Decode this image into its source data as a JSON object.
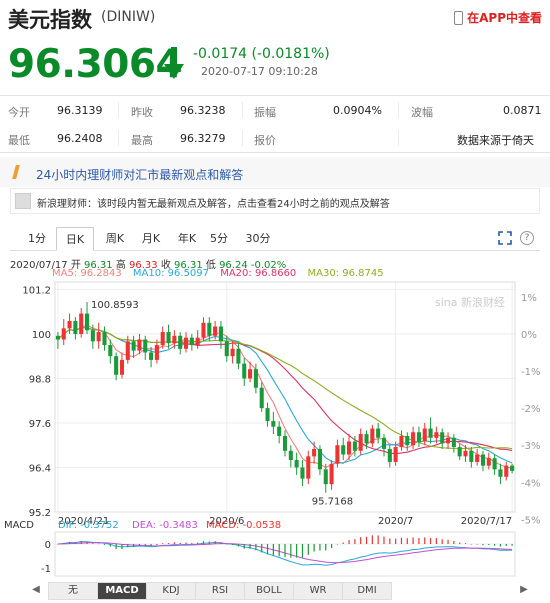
{
  "header": {
    "title": "美元指数",
    "code": "(DINIW)",
    "app_link": "在APP中查看",
    "price": "96.3064",
    "change": "-0.0174 (-0.0181%)",
    "time": "2020-07-17 09:10:28"
  },
  "quote": {
    "row1": [
      {
        "label": "今开",
        "value": "96.3139"
      },
      {
        "label": "昨收",
        "value": "96.3238"
      },
      {
        "label": "振幅",
        "value": "0.0904%"
      },
      {
        "label": "波幅",
        "value": "0.0871"
      }
    ],
    "row2": [
      {
        "label": "最低",
        "value": "96.2408"
      },
      {
        "label": "最高",
        "value": "96.3279"
      },
      {
        "label": "报价",
        "value": ""
      },
      {
        "label": "",
        "value": "数据来源于倚天"
      }
    ]
  },
  "banner": "24小时内理财师对汇市最新观点和解答",
  "advisor": "新浪理财师：该时段内暂无最新观点及解答，点击查看24小时之前的观点及解答",
  "tabs": [
    "1分",
    "日K",
    "周K",
    "月K",
    "年K",
    "5分",
    "30分"
  ],
  "active_tab": "日K",
  "ohlc_info": {
    "date": "2020/07/17",
    "open_label": "开",
    "open": "96.31",
    "high_label": "高",
    "high": "96.33",
    "close_label": "收",
    "close": "96.31",
    "low_label": "低",
    "low": "96.24",
    "pct": "-0.02%"
  },
  "ma": [
    {
      "text": "MA5: 96.2843",
      "color": "#f08080"
    },
    {
      "text": "MA10: 96.5097",
      "color": "#2aa8d6"
    },
    {
      "text": "MA20: 96.8660",
      "color": "#e0306a"
    },
    {
      "text": "MA30: 96.8745",
      "color": "#8ab020"
    }
  ],
  "watermark": "sina 新浪财经",
  "chart_data": {
    "type": "candlestick",
    "y_ticks": [
      "101.2",
      "100",
      "98.8",
      "97.6",
      "96.4",
      "95.2"
    ],
    "pct_ticks": [
      "1%",
      "0%",
      "-1%",
      "-2%",
      "-3%",
      "-4%",
      "-5%"
    ],
    "x_labels": [
      "2020/4/21",
      "2020/6",
      "2020/7",
      "2020/7/17"
    ],
    "max_label": "100.8593",
    "min_label": "95.7168",
    "y_range": [
      95.2,
      101.4
    ],
    "candles": [
      [
        99.95,
        99.85,
        100.05,
        99.6
      ],
      [
        99.85,
        100.15,
        100.4,
        99.7
      ],
      [
        100.15,
        100.35,
        100.55,
        100.0
      ],
      [
        100.35,
        100.0,
        100.45,
        99.85
      ],
      [
        100.0,
        100.55,
        100.7,
        99.9
      ],
      [
        100.55,
        100.1,
        100.86,
        100.0
      ],
      [
        100.1,
        99.8,
        100.25,
        99.6
      ],
      [
        99.8,
        100.05,
        100.3,
        99.6
      ],
      [
        100.05,
        99.7,
        100.2,
        99.55
      ],
      [
        99.7,
        99.4,
        99.85,
        99.2
      ],
      [
        99.4,
        98.9,
        99.5,
        98.75
      ],
      [
        98.9,
        99.3,
        99.5,
        98.8
      ],
      [
        99.3,
        99.8,
        99.95,
        99.2
      ],
      [
        99.8,
        99.55,
        99.95,
        99.35
      ],
      [
        99.55,
        99.85,
        100.0,
        99.45
      ],
      [
        99.85,
        99.5,
        99.95,
        99.3
      ],
      [
        99.5,
        99.3,
        99.65,
        99.1
      ],
      [
        99.3,
        99.7,
        99.85,
        99.2
      ],
      [
        99.7,
        100.05,
        100.2,
        99.6
      ],
      [
        100.05,
        99.75,
        100.25,
        99.6
      ],
      [
        99.75,
        99.95,
        100.1,
        99.6
      ],
      [
        99.95,
        99.6,
        100.05,
        99.45
      ],
      [
        99.6,
        99.9,
        100.05,
        99.5
      ],
      [
        99.9,
        99.7,
        100.0,
        99.55
      ],
      [
        99.7,
        99.9,
        100.1,
        99.6
      ],
      [
        99.9,
        100.3,
        100.45,
        99.8
      ],
      [
        100.3,
        99.95,
        100.45,
        99.8
      ],
      [
        99.95,
        100.2,
        100.35,
        99.85
      ],
      [
        100.2,
        99.8,
        100.35,
        99.6
      ],
      [
        99.8,
        99.4,
        99.95,
        99.25
      ],
      [
        99.4,
        99.6,
        99.8,
        99.2
      ],
      [
        99.6,
        99.2,
        99.75,
        99.05
      ],
      [
        99.2,
        98.8,
        99.35,
        98.6
      ],
      [
        98.8,
        99.05,
        99.25,
        98.7
      ],
      [
        99.05,
        98.55,
        99.2,
        98.4
      ],
      [
        98.55,
        98.0,
        98.7,
        97.9
      ],
      [
        98.0,
        97.65,
        98.15,
        97.5
      ],
      [
        97.65,
        97.5,
        97.9,
        97.3
      ],
      [
        97.5,
        97.25,
        97.65,
        97.05
      ],
      [
        97.25,
        96.85,
        97.4,
        96.7
      ],
      [
        96.85,
        96.6,
        97.0,
        96.4
      ],
      [
        96.6,
        96.4,
        96.8,
        96.2
      ],
      [
        96.4,
        96.1,
        96.6,
        95.9
      ],
      [
        96.1,
        96.7,
        96.85,
        95.95
      ],
      [
        96.7,
        96.9,
        97.1,
        96.5
      ],
      [
        96.9,
        96.35,
        97.0,
        96.2
      ],
      [
        96.35,
        95.95,
        96.5,
        95.72
      ],
      [
        95.95,
        96.5,
        96.6,
        95.8
      ],
      [
        96.5,
        97.0,
        97.15,
        96.4
      ],
      [
        97.0,
        96.75,
        97.2,
        96.6
      ],
      [
        96.75,
        97.1,
        97.3,
        96.6
      ],
      [
        97.1,
        96.85,
        97.25,
        96.7
      ],
      [
        96.85,
        97.3,
        97.45,
        96.75
      ],
      [
        97.3,
        97.05,
        97.4,
        96.9
      ],
      [
        97.05,
        97.45,
        97.55,
        96.95
      ],
      [
        97.45,
        97.2,
        97.6,
        97.05
      ],
      [
        97.2,
        96.9,
        97.3,
        96.7
      ],
      [
        96.9,
        96.55,
        97.0,
        96.4
      ],
      [
        96.55,
        96.95,
        97.1,
        96.45
      ],
      [
        96.95,
        97.25,
        97.4,
        96.85
      ],
      [
        97.25,
        97.0,
        97.35,
        96.85
      ],
      [
        97.0,
        97.35,
        97.5,
        96.9
      ],
      [
        97.35,
        97.1,
        97.5,
        96.95
      ],
      [
        97.1,
        97.45,
        97.6,
        97.0
      ],
      [
        97.45,
        97.2,
        97.75,
        97.05
      ],
      [
        97.2,
        97.35,
        97.5,
        97.05
      ],
      [
        97.35,
        97.05,
        97.45,
        96.9
      ],
      [
        97.05,
        97.2,
        97.35,
        96.9
      ],
      [
        97.2,
        96.95,
        97.3,
        96.8
      ],
      [
        96.95,
        96.7,
        97.05,
        96.6
      ],
      [
        96.7,
        96.85,
        97.0,
        96.55
      ],
      [
        96.85,
        96.55,
        96.95,
        96.4
      ],
      [
        96.55,
        96.75,
        96.9,
        96.45
      ],
      [
        96.75,
        96.45,
        96.85,
        96.3
      ],
      [
        96.45,
        96.65,
        96.8,
        96.35
      ],
      [
        96.65,
        96.35,
        96.75,
        96.2
      ],
      [
        96.35,
        96.15,
        96.5,
        95.95
      ],
      [
        96.15,
        96.45,
        96.55,
        96.05
      ],
      [
        96.45,
        96.31,
        96.5,
        96.24
      ]
    ],
    "ma_series": [
      {
        "name": "MA5",
        "color": "#f08080"
      },
      {
        "name": "MA10",
        "color": "#2aa8d6"
      },
      {
        "name": "MA20",
        "color": "#e0306a"
      },
      {
        "name": "MA30",
        "color": "#8ab020"
      }
    ],
    "macd": {
      "label": "MACD",
      "dif": "DIF: -0.3752",
      "dea": "DEA: -0.3483",
      "macd": "MACD: -0.0538",
      "y_ticks": [
        "0",
        "-1"
      ]
    }
  },
  "bottom_tabs": [
    "无",
    "MACD",
    "KDJ",
    "RSI",
    "BOLL",
    "WR",
    "DMI"
  ],
  "bottom_active": "MACD"
}
